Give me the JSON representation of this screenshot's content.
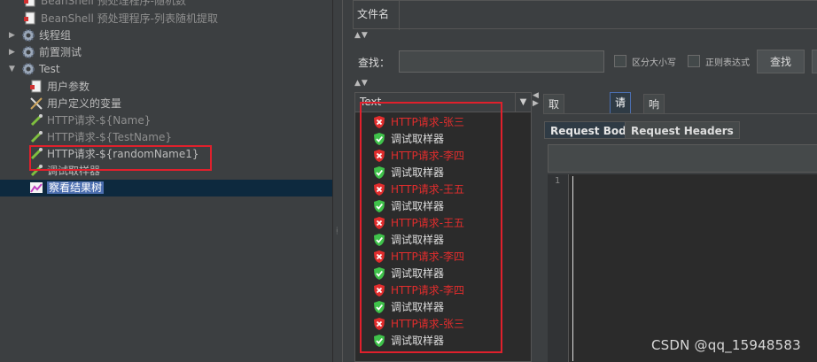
{
  "tree": {
    "items": [
      {
        "label": "BeanShell 预处理程序-随机数"
      },
      {
        "label": "BeanShell 预处理程序-列表随机提取"
      },
      {
        "label": "线程组"
      },
      {
        "label": "前置测试"
      },
      {
        "label": "Test"
      },
      {
        "label": "用户参数"
      },
      {
        "label": "用户定义的变量"
      },
      {
        "label": "HTTP请求-${Name}"
      },
      {
        "label": "HTTP请求-${TestName}"
      },
      {
        "label": "HTTP请求-${randomName1}"
      },
      {
        "label": "调试取样器"
      },
      {
        "label": "察看结果树"
      }
    ]
  },
  "filename_header": "文件名",
  "search": {
    "label": "查找：",
    "value": "",
    "case_label": "区分大小写",
    "regex_label": "正则表达式",
    "button": "查找"
  },
  "results": {
    "header": "Text",
    "items": [
      {
        "label": "HTTP请求-张三",
        "status": "fail"
      },
      {
        "label": "调试取样器",
        "status": "ok"
      },
      {
        "label": "HTTP请求-李四",
        "status": "fail"
      },
      {
        "label": "调试取样器",
        "status": "ok"
      },
      {
        "label": "HTTP请求-王五",
        "status": "fail"
      },
      {
        "label": "调试取样器",
        "status": "ok"
      },
      {
        "label": "HTTP请求-王五",
        "status": "fail"
      },
      {
        "label": "调试取样器",
        "status": "ok"
      },
      {
        "label": "HTTP请求-李四",
        "status": "fail"
      },
      {
        "label": "调试取样器",
        "status": "ok"
      },
      {
        "label": "HTTP请求-李四",
        "status": "fail"
      },
      {
        "label": "调试取样器",
        "status": "ok"
      },
      {
        "label": "HTTP请求-张三",
        "status": "fail"
      },
      {
        "label": "调试取样器",
        "status": "ok"
      }
    ]
  },
  "tabs": [
    "取样器结果",
    "请求",
    "响应数据"
  ],
  "subtabs": [
    "Request Body",
    "Request Headers"
  ],
  "editor": {
    "line_number": "1"
  },
  "watermark": "CSDN @qq_15948583",
  "colors": {
    "fail": "#e22d2d",
    "ok": "#3fc24a",
    "selection": "#4b6eaf",
    "highlight_box": "#e0202c"
  }
}
